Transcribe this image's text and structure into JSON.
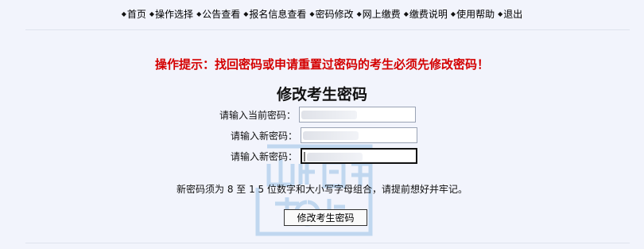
{
  "nav": {
    "items": [
      {
        "label": "首页"
      },
      {
        "label": "操作选择"
      },
      {
        "label": "公告查看"
      },
      {
        "label": "报名信息查看"
      },
      {
        "label": "密码修改"
      },
      {
        "label": "网上缴费"
      },
      {
        "label": "缴费说明"
      },
      {
        "label": "使用帮助"
      },
      {
        "label": "退出"
      }
    ],
    "bullet_icon": "diamond-bullet-icon"
  },
  "hint": "操作提示：找回密码或申请重置过密码的考生必须先修改密码！",
  "form": {
    "title": "修改考生密码",
    "current_label": "请输入当前密码：",
    "new_label": "请输入新密码：",
    "confirm_label": "请输入新密码：",
    "note": "新密码须为 8 至 1 5 位数字和大小写字母组合，请提前想好并牢记。",
    "submit_label": "修改考生密码"
  },
  "colors": {
    "background": "#f2f4fc",
    "hint_red": "#d40000",
    "watermark": "#9fc4e8"
  }
}
